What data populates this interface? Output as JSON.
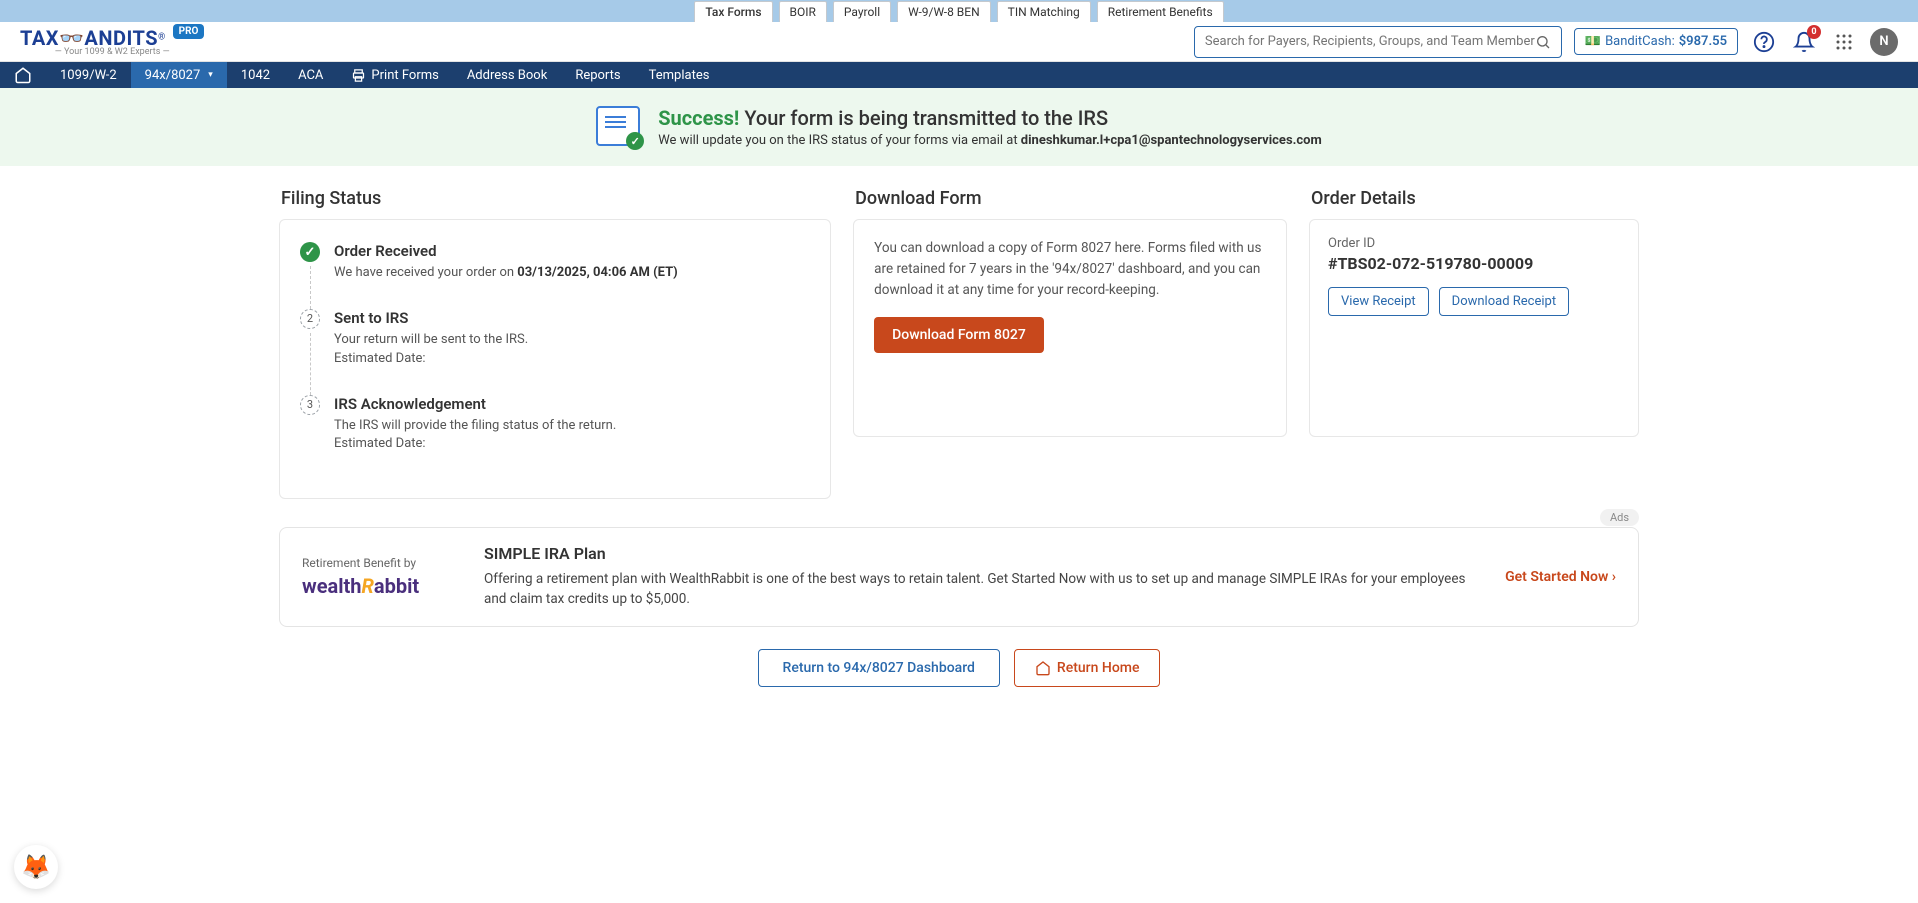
{
  "top_tabs": [
    "Tax Forms",
    "BOIR",
    "Payroll",
    "W-9/W-8 BEN",
    "TIN Matching",
    "Retirement Benefits"
  ],
  "top_tab_active": 0,
  "logo": {
    "text1": "TAX",
    "text2": "ANDITS",
    "reg": "®",
    "pro": "PRO",
    "tagline": "— Your 1099 & W2 Experts —"
  },
  "search": {
    "placeholder": "Search for Payers, Recipients, Groups, and Team Members"
  },
  "bandit_cash": {
    "label": "BanditCash:",
    "amount": "$987.55"
  },
  "notif_count": "0",
  "avatar_letter": "N",
  "nav": [
    "1099/W-2",
    "94x/8027",
    "1042",
    "ACA",
    "Print Forms",
    "Address Book",
    "Reports",
    "Templates"
  ],
  "nav_active": 1,
  "success": {
    "ok": "Success!",
    "headline": "Your form is being transmitted to the IRS",
    "sub": "We will update you on the IRS status of your forms via email at ",
    "email": "dineshkumar.l+cpa1@spantechnologyservices.com"
  },
  "filing": {
    "title": "Filing Status",
    "steps": [
      {
        "done": true,
        "num": "✓",
        "title": "Order Received",
        "line": "We have received your order on ",
        "strong": "03/13/2025, 04:06 AM (ET)"
      },
      {
        "done": false,
        "num": "2",
        "title": "Sent to IRS",
        "line": "Your return will be sent to the IRS.",
        "extra": "Estimated Date:"
      },
      {
        "done": false,
        "num": "3",
        "title": "IRS Acknowledgement",
        "line": "The IRS will provide the filing status of the return.",
        "extra": "Estimated Date:"
      }
    ]
  },
  "download": {
    "title": "Download Form",
    "text": "You can download a copy of Form 8027 here. Forms filed with us are retained for 7 years in the '94x/8027' dashboard, and you can download it at any time for your record-keeping.",
    "button": "Download Form 8027"
  },
  "order": {
    "title": "Order Details",
    "id_label": "Order ID",
    "id": "#TBS02-072-519780-00009",
    "view": "View Receipt",
    "download": "Download Receipt"
  },
  "ad": {
    "tag": "Ads",
    "ret": "Retirement Benefit by",
    "brand1": "wealth",
    "brand2": "R",
    "brand3": "abbit",
    "title": "SIMPLE IRA Plan",
    "text": "Offering a retirement plan with WealthRabbit is one of the best ways to retain talent. Get Started Now with us to set up and manage SIMPLE IRAs for your employees and claim tax credits up to $5,000.",
    "cta": "Get Started Now"
  },
  "bottom": {
    "dash": "Return to 94x/8027 Dashboard",
    "home": "Return Home"
  }
}
